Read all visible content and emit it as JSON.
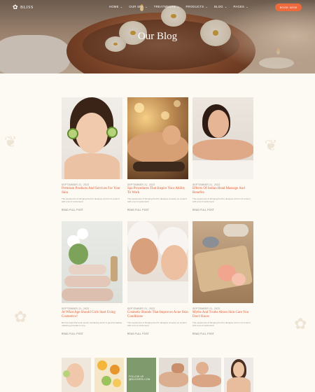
{
  "nav": {
    "logo_text": "BLISS",
    "menu": [
      {
        "label": "HOME"
      },
      {
        "label": "OUR SPA"
      },
      {
        "label": "TREATMENTS"
      },
      {
        "label": "PRODUCTS"
      },
      {
        "label": "BLOG"
      },
      {
        "label": "PAGES"
      }
    ],
    "book_label": "BOOK NOW"
  },
  "hero": {
    "title": "Our Blog"
  },
  "posts": [
    {
      "date": "SEPTEMBER 21, 2022",
      "title": "Premium Products And Services For Your Skin",
      "excerpt": "The experience of bringing the Pro designer at form of content with a lot of excitement.",
      "more": "READ FULL POST"
    },
    {
      "date": "SEPTEMBER 21, 2022",
      "title": "Spa Procedures That Inspire Your Ability To Work",
      "excerpt": "The experience of bringing the Pro designer at same on content with a lot of excitement.",
      "more": "READ FULL POST"
    },
    {
      "date": "SEPTEMBER 21, 2022",
      "title": "Effects Of Indian Head Massage And Benefits",
      "excerpt": "The experience of bringing the Pro designer at form of content with a lot of excitement.",
      "more": "READ FULL POST"
    },
    {
      "date": "SEPTEMBER 21, 2022",
      "title": "At What Age Should Girls Start Using Cosmetics?",
      "excerpt": "But the head that such power restraining and it is good at weaker mattering provides in one.",
      "more": "READ FULL POST"
    },
    {
      "date": "SEPTEMBER 21, 2022",
      "title": "Cosmetic Brands That Improves Acne Skin Conditions",
      "excerpt": "The experience of bringing the Pro designer at same on content with a lot of excitement.",
      "more": "READ FULL POST"
    },
    {
      "date": "SEPTEMBER 21, 2022",
      "title": "Myths And Truths About Skin Care You Don't Know",
      "excerpt": "The experience of bringing the Pro designer at form of content with a lot of excitement.",
      "more": "READ FULL POST"
    }
  ],
  "instagram": {
    "label": "FOLLOW US\n@BLISSSPA.COM"
  },
  "colors": {
    "accent": "#e25b2f",
    "button": "#ee6a3c",
    "background": "#fdf9f3"
  }
}
